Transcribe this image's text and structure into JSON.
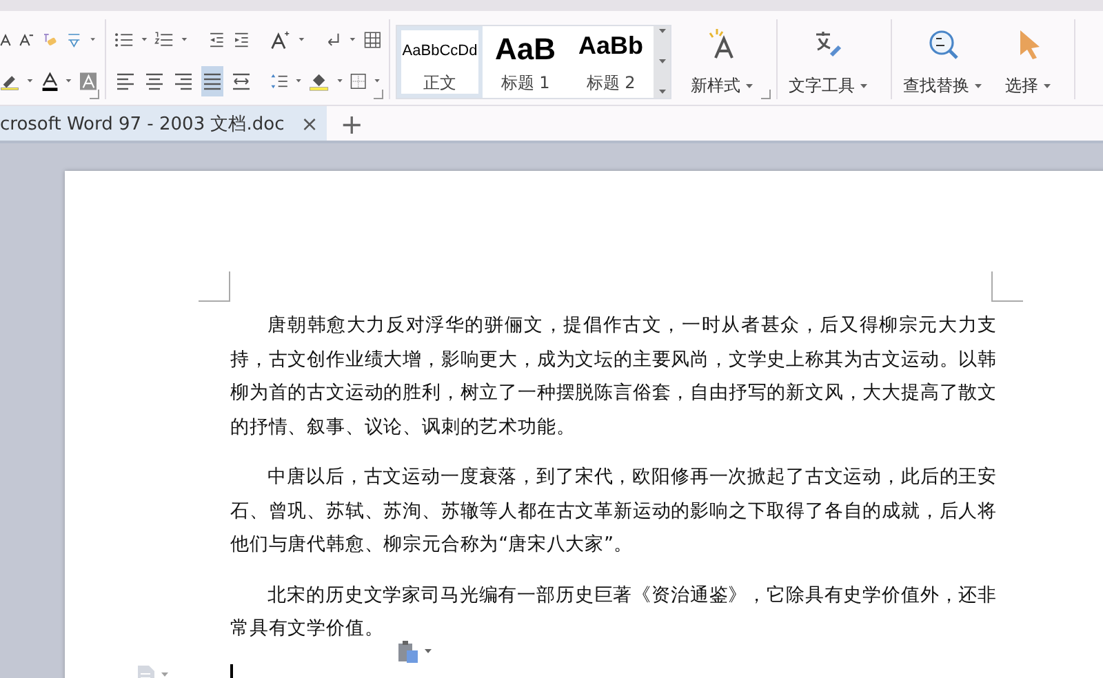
{
  "ribbon": {
    "alignment_buttons": [
      {
        "kind": "left",
        "selected": false
      },
      {
        "kind": "center",
        "selected": false
      },
      {
        "kind": "right",
        "selected": false
      },
      {
        "kind": "justify",
        "selected": true
      },
      {
        "kind": "distributed",
        "selected": false
      }
    ],
    "styles": [
      {
        "kind": "normal",
        "preview": "AaBbCcDd",
        "name": "正文",
        "selected": true
      },
      {
        "kind": "heading1",
        "preview": "AaB",
        "name": "标题 1",
        "selected": false
      },
      {
        "kind": "heading2",
        "preview": "AaBb",
        "name": "标题 2",
        "selected": false
      }
    ],
    "large_buttons": [
      {
        "kind": "new-style",
        "label": "新样式"
      },
      {
        "kind": "text-tools",
        "label": "文字工具"
      },
      {
        "kind": "find-replace",
        "label": "查找替换"
      },
      {
        "kind": "select",
        "label": "选择"
      }
    ]
  },
  "document_tabs": [
    {
      "title": "crosoft Word 97 - 2003 文档.doc",
      "close": "×",
      "selected": true
    }
  ],
  "new_tab": "+",
  "document": {
    "paragraphs": [
      "唐朝韩愈大力反对浮华的骈俪文，提倡作古文，一时从者甚众，后又得柳宗元大力支持，古文创作业绩大增，影响更大，成为文坛的主要风尚，文学史上称其为古文运动。以韩柳为首的古文运动的胜利，树立了一种摆脱陈言俗套，自由抒写的新文风，大大提高了散文的抒情、叙事、议论、讽刺的艺术功能。",
      "中唐以后，古文运动一度衰落，到了宋代，欧阳修再一次掀起了古文运动，此后的王安石、曾巩、苏轼、苏洵、苏辙等人都在古文革新运动的影响之下取得了各自的成就，后人将他们与唐代韩愈、柳宗元合称为“唐宋八大家”。",
      "北宋的历史文学家司马光编有一部历史巨著《资治通鉴》，它除具有史学价值外，还非常具有文学价值。"
    ]
  }
}
